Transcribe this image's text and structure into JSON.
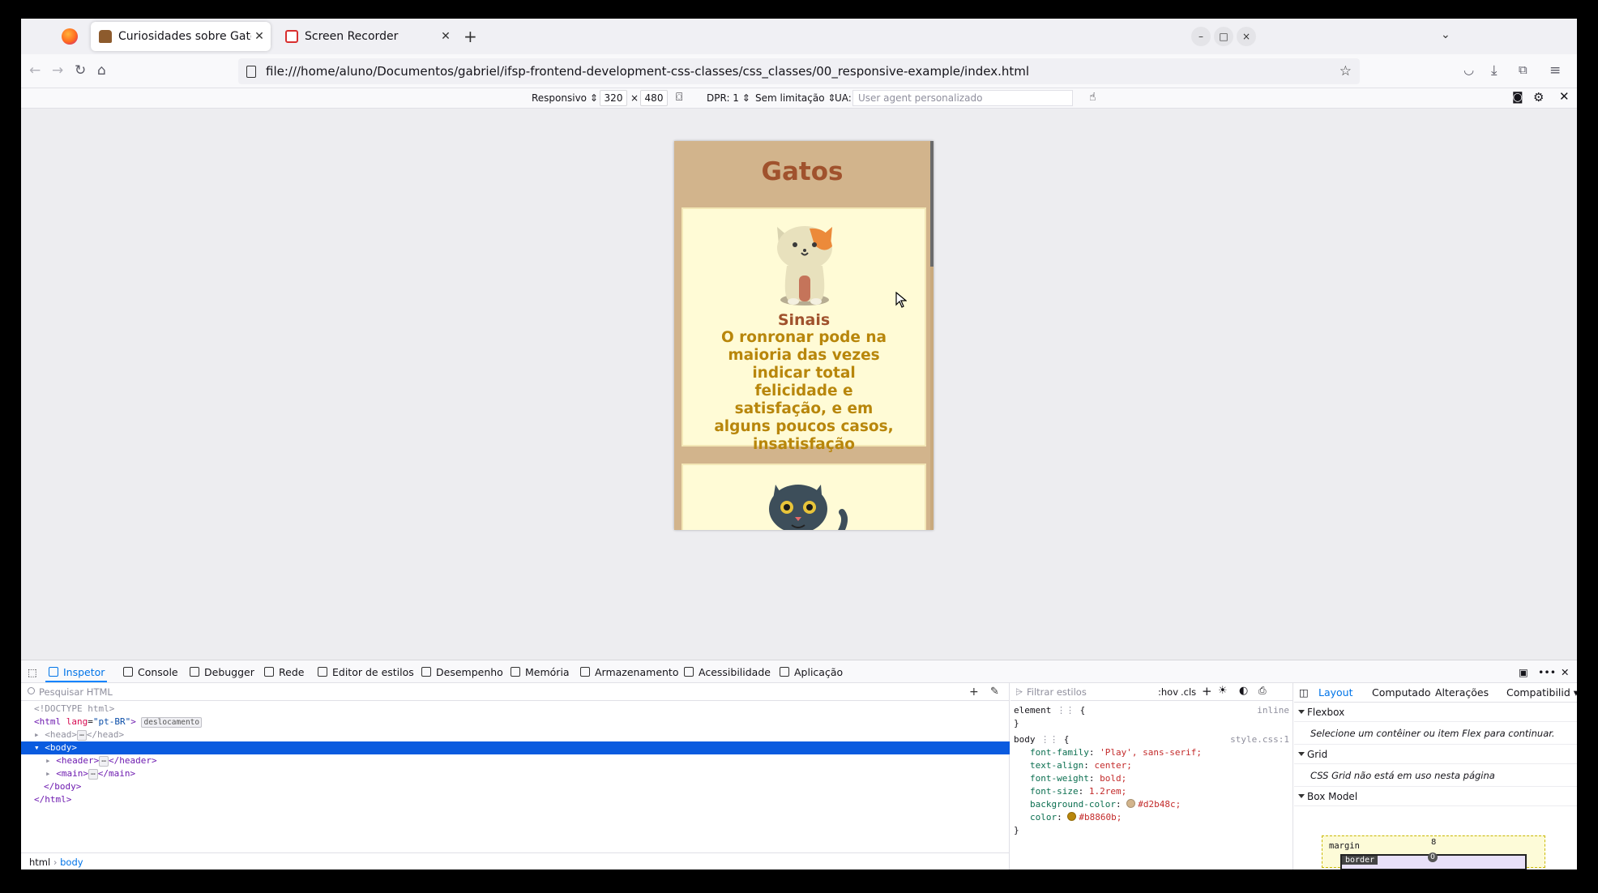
{
  "browser": {
    "tabs": [
      {
        "title": "Curiosidades sobre Gatos"
      },
      {
        "title": "Screen Recorder"
      }
    ],
    "tab_close": "✕",
    "url": "file:///home/aluno/Documentos/gabriel/ifsp-frontend-development-css-classes/css_classes/00_responsive-example/index.html"
  },
  "rdm": {
    "device": "Responsivo",
    "width": "320",
    "times": "×",
    "height": "480",
    "dpr": "DPR: 1",
    "throttle": "Sem limitação",
    "ua_label": "UA:",
    "ua_placeholder": "User agent personalizado"
  },
  "page": {
    "title": "Gatos",
    "card1": {
      "heading": "Sinais",
      "text": "O ronronar pode na maioria das vezes indicar total felicidade e satisfação, e em alguns poucos casos, insatisfação"
    },
    "colors": {
      "background": "#d2b48c",
      "text": "#b8860b",
      "heading": "#a0522d",
      "card": "#fffbd6"
    }
  },
  "devtools": {
    "tabs": [
      "Inspetor",
      "Console",
      "Debugger",
      "Rede",
      "Editor de estilos",
      "Desempenho",
      "Memória",
      "Armazenamento",
      "Acessibilidade",
      "Aplicação"
    ],
    "html_search_placeholder": "Pesquisar HTML",
    "html_lines": {
      "doctype": "<!DOCTYPE html>",
      "html_open_tag": "<html",
      "html_lang_attr": "lang",
      "html_lang_val": "\"pt-BR\"",
      "html_open_end": ">",
      "badge": "deslocamento",
      "head": "<head>",
      "head_close": "</head>",
      "body": "<body>",
      "header": "<header>",
      "header_close": "</header>",
      "main": "<main>",
      "main_close": "</main>",
      "body_close": "</body>",
      "html_close": "</html>",
      "ellipsis": "⋯"
    },
    "breadcrumbs": [
      "html",
      "body"
    ],
    "styles": {
      "filter_placeholder": "Filtrar estilos",
      "hov": ":hov",
      "cls": ".cls",
      "element_rule": "element",
      "element_source": "inline",
      "body_rule": "body",
      "body_source": "style.css:1",
      "open_brace": "{",
      "close_brace": "}",
      "declarations": [
        {
          "prop": "font-family",
          "value": "'Play', sans-serif;"
        },
        {
          "prop": "text-align",
          "value": "center;"
        },
        {
          "prop": "font-weight",
          "value": "bold;"
        },
        {
          "prop": "font-size",
          "value": "1.2rem;"
        },
        {
          "prop": "background-color",
          "value": "#d2b48c;"
        },
        {
          "prop": "color",
          "value": "#b8860b;"
        }
      ]
    },
    "layout": {
      "tabs": [
        "Layout",
        "Computado",
        "Alterações",
        "Compatibilid"
      ],
      "flexbox_title": "Flexbox",
      "flexbox_msg": "Selecione um contêiner ou item Flex para continuar.",
      "grid_title": "Grid",
      "grid_msg": "CSS Grid não está em uso nesta página",
      "boxmodel_title": "Box Model",
      "margin_label": "margin",
      "margin_value": "8",
      "border_label": "border",
      "border_value": "0"
    }
  }
}
